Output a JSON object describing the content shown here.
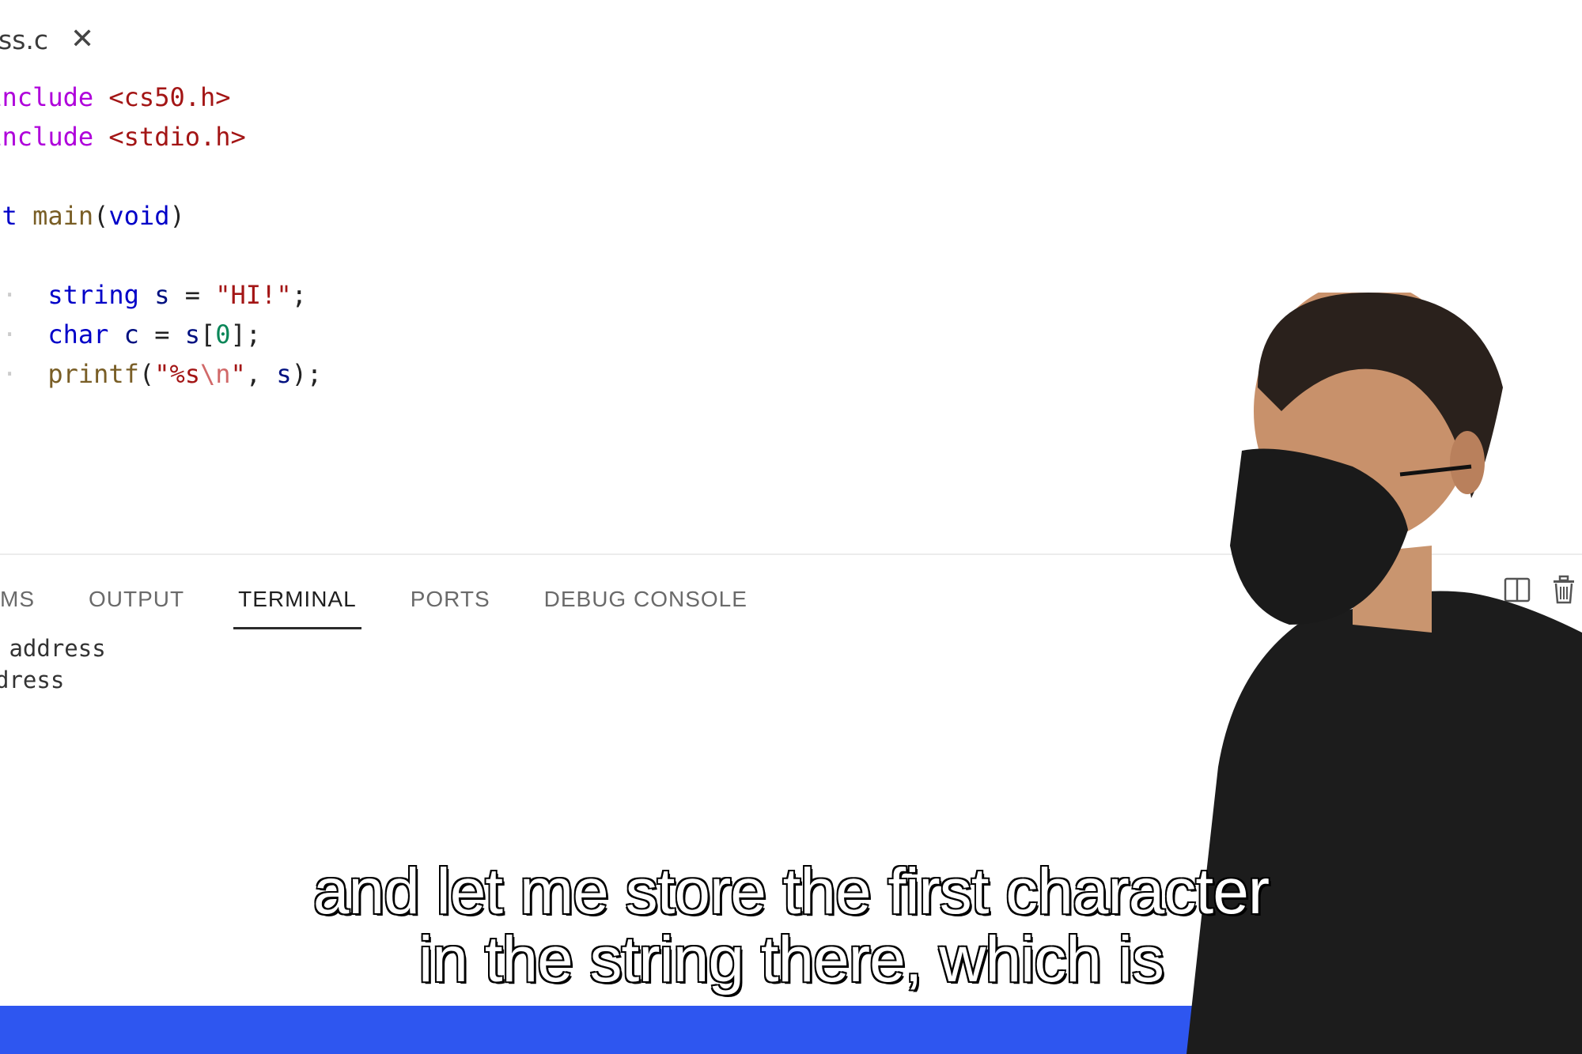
{
  "editor": {
    "tab": {
      "filename": "ss.c",
      "close_glyph": "✕"
    },
    "lines": [
      {
        "kind": "include",
        "keyword": "nclude",
        "header": "<cs50.h>"
      },
      {
        "kind": "include",
        "keyword": "nclude",
        "header": "<stdio.h>"
      },
      {
        "kind": "blank"
      },
      {
        "kind": "main",
        "type": "t",
        "name": "main",
        "open": "(",
        "param": "void",
        "close": ")"
      },
      {
        "kind": "blank"
      },
      {
        "kind": "stmt1",
        "type": "string",
        "var": "s",
        "eq": "=",
        "value": "\"HI!\"",
        "end": ";"
      },
      {
        "kind": "stmt2",
        "type": "char",
        "var": "c",
        "eq": "=",
        "arr": "s",
        "lb": "[",
        "idx": "0",
        "rb": "];"
      },
      {
        "kind": "stmt3",
        "fn": "printf",
        "open": "(",
        "fmt_a": "\"%s",
        "fmt_esc": "\\n",
        "fmt_b": "\"",
        "comma": ",",
        "arg": "s",
        "end": ");"
      }
    ]
  },
  "panel": {
    "tabs": [
      {
        "label": "MS",
        "active": false
      },
      {
        "label": "OUTPUT",
        "active": false
      },
      {
        "label": "TERMINAL",
        "active": true
      },
      {
        "label": "PORTS",
        "active": false
      },
      {
        "label": "DEBUG CONSOLE",
        "active": false
      }
    ],
    "actions": [
      "split-terminal-icon",
      "trash-icon"
    ],
    "terminal_lines": [
      " address",
      "dress"
    ]
  },
  "caption": {
    "line1": "and let me store the first character",
    "line2": "in the string there, which is"
  },
  "colors": {
    "statusbar": "#2e56f0",
    "include": "#af00db",
    "string": "#a31515",
    "type": "#0000c8"
  }
}
